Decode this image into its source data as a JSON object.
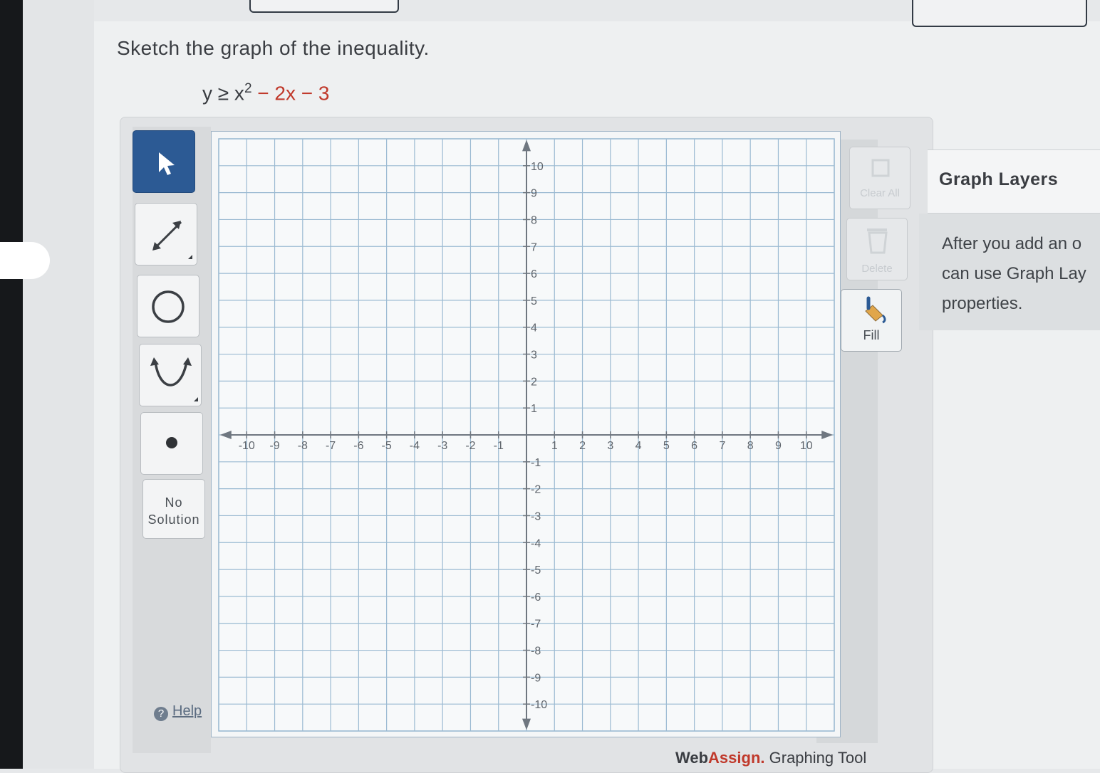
{
  "question": {
    "prompt": "Sketch the graph of the inequality.",
    "inequality_lhs": "y ≥ x",
    "inequality_exp": "2",
    "inequality_rhs": " − 2x − 3"
  },
  "toolbar": {
    "tools": [
      {
        "name": "select-tool",
        "icon": "pointer-arrow-icon",
        "active": true
      },
      {
        "name": "line-tool",
        "icon": "double-arrow-line-icon"
      },
      {
        "name": "circle-tool",
        "icon": "circle-icon"
      },
      {
        "name": "parabola-tool",
        "icon": "parabola-icon"
      },
      {
        "name": "point-tool",
        "icon": "point-icon"
      }
    ],
    "no_solution_line1": "No",
    "no_solution_line2": "Solution",
    "help_label": "Help"
  },
  "actions": {
    "clear_all_label": "Clear All",
    "delete_label": "Delete",
    "fill_label": "Fill"
  },
  "graph": {
    "x_ticks": [
      "-10",
      "-9",
      "-8",
      "-7",
      "-6",
      "-5",
      "-4",
      "-3",
      "-2",
      "-1",
      "1",
      "2",
      "3",
      "4",
      "5",
      "6",
      "7",
      "8",
      "9",
      "10"
    ],
    "y_ticks": [
      "10",
      "9",
      "8",
      "7",
      "6",
      "5",
      "4",
      "3",
      "2",
      "1",
      "-1",
      "-2",
      "-3",
      "-4",
      "-5",
      "-6",
      "-7",
      "-8",
      "-9",
      "-10"
    ],
    "xlim": [
      -10,
      10
    ],
    "ylim": [
      -10,
      10
    ],
    "grid_color": "#9bbad2",
    "axis_color": "#6f7780"
  },
  "layers": {
    "title": "Graph Layers",
    "line1": "After you add an o",
    "line2": "can use Graph Lay",
    "line3": "properties."
  },
  "footer": {
    "brand_part1": "Web",
    "brand_part2": "Assign.",
    "tool_name": " Graphing Tool"
  }
}
